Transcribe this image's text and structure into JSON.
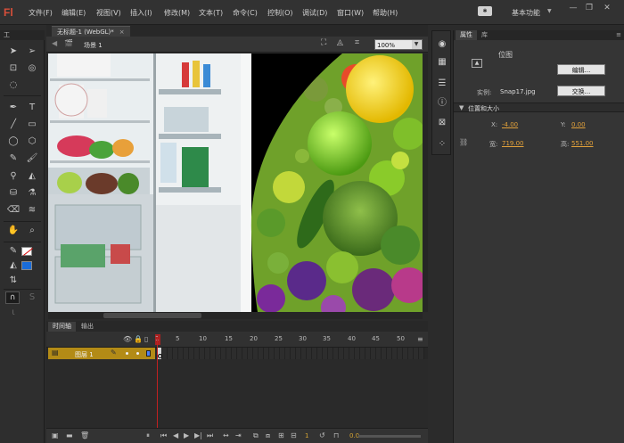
{
  "app": {
    "logo": "Fl"
  },
  "menu": [
    "文件(F)",
    "编辑(E)",
    "视图(V)",
    "插入(I)",
    "修改(M)",
    "文本(T)",
    "命令(C)",
    "控制(O)",
    "调试(D)",
    "窗口(W)",
    "帮助(H)"
  ],
  "workspace": {
    "badge": "✱",
    "label": "基本功能",
    "arrow": "▼"
  },
  "window_controls": {
    "minimize": "—",
    "restore": "❐",
    "close": "✕"
  },
  "tools": {
    "header": "工"
  },
  "document": {
    "tab_title": "无标题-1 (WebGL)*",
    "close": "×",
    "scene": "场景 1",
    "zoom": "100%"
  },
  "timeline": {
    "tabs": [
      "时间轴",
      "输出"
    ],
    "ruler": [
      "1",
      "5",
      "10",
      "15",
      "20",
      "25",
      "30",
      "35",
      "40",
      "45",
      "50"
    ],
    "layer_name": "图层 1",
    "current_frame": "1",
    "fps": "0.0"
  },
  "properties": {
    "tabs": [
      "属性",
      "库"
    ],
    "type": "位图",
    "edit_button": "编辑...",
    "instance_label": "实例:",
    "instance_value": "Snap17.jpg",
    "swap_button": "交换...",
    "section_title": "位置和大小",
    "x_label": "X:",
    "x_value": "-4.00",
    "y_label": "Y:",
    "y_value": "0.00",
    "w_label": "宽:",
    "w_value": "719.00",
    "h_label": "高:",
    "h_value": "551.00"
  },
  "colors": {
    "accent": "#d94f3a",
    "layer": "#b38b16",
    "value": "#e2a13a",
    "fill": "#1a6cd8",
    "playhead": "#c02020"
  }
}
